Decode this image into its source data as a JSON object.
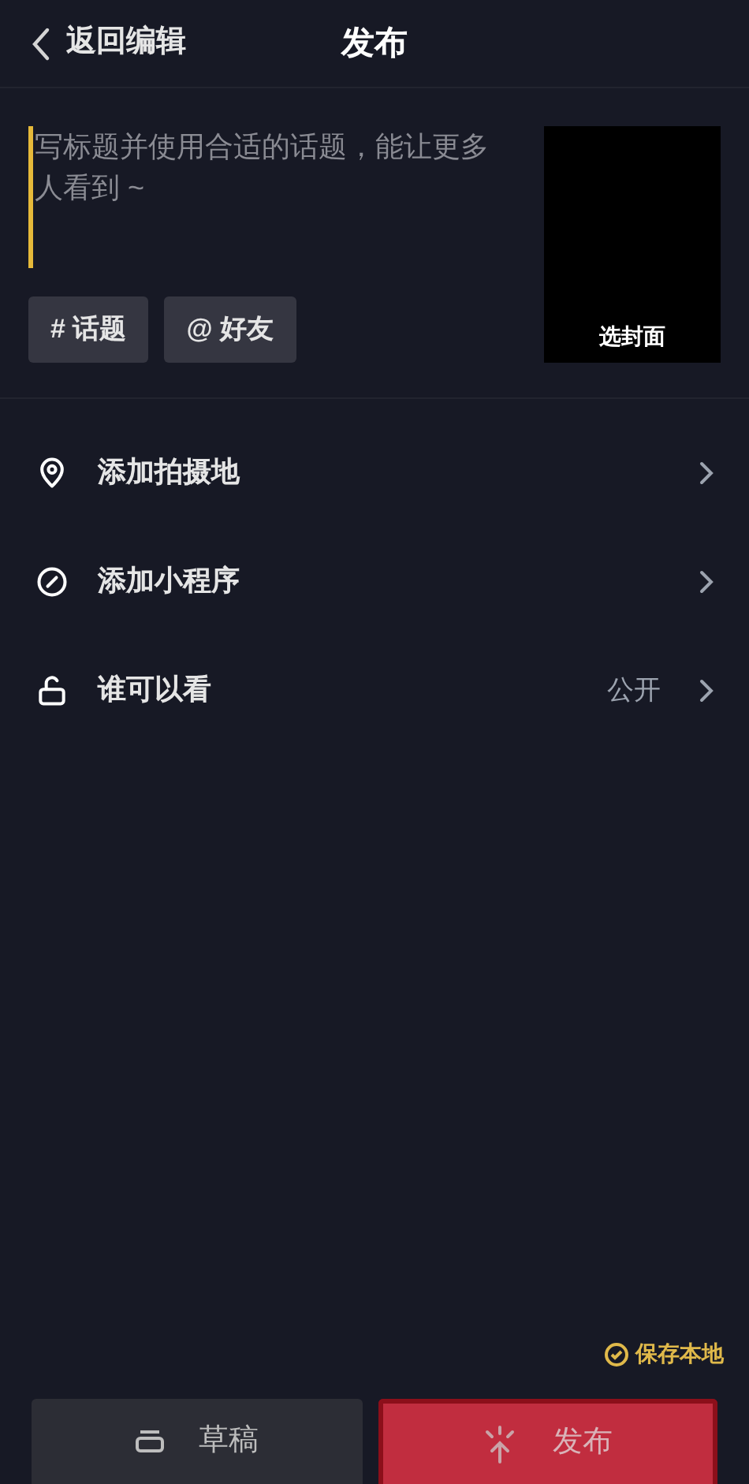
{
  "header": {
    "back_label": "返回编辑",
    "title": "发布"
  },
  "caption": {
    "placeholder": "写标题并使用合适的话题，能让更多人看到 ~"
  },
  "tags": [
    {
      "symbol": "#",
      "label": "话题"
    },
    {
      "symbol": "@",
      "label": "好友"
    }
  ],
  "cover": {
    "label": "选封面"
  },
  "options": [
    {
      "kind": "location",
      "label": "添加拍摄地"
    },
    {
      "kind": "miniprogram",
      "label": "添加小程序"
    },
    {
      "kind": "privacy",
      "label": "谁可以看",
      "value": "公开"
    }
  ],
  "save_local": {
    "label": "保存本地",
    "checked": true
  },
  "buttons": [
    {
      "kind": "draft",
      "label": "草稿"
    },
    {
      "kind": "publish",
      "label": "发布"
    }
  ]
}
